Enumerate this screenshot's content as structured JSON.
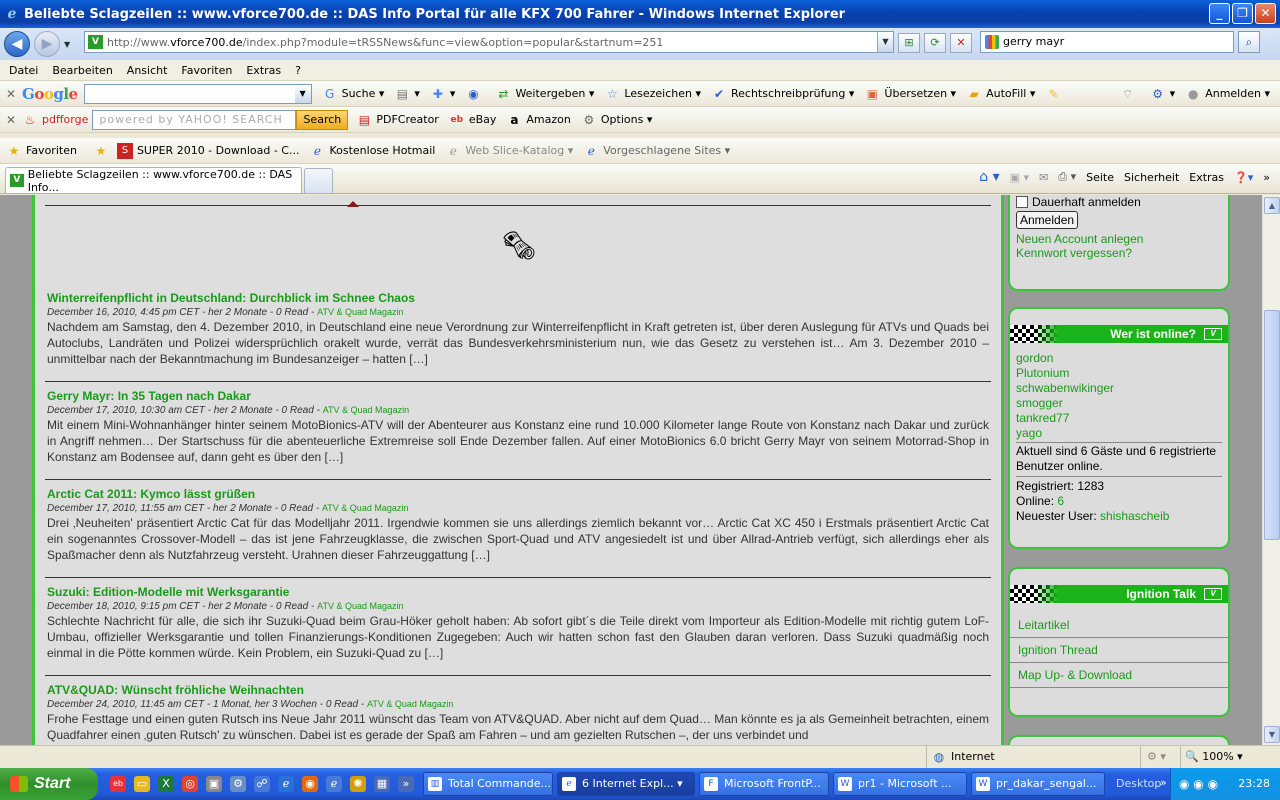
{
  "window": {
    "title": "Beliebte Sclagzeilen :: www.vforce700.de :: DAS Info Portal für alle KFX 700 Fahrer - Windows Internet Explorer",
    "minimize_label": "_",
    "maximize_label": "❐",
    "close_label": "✕"
  },
  "address": {
    "url_prefix": "http://www.",
    "url_host": "vforce700.de",
    "url_path": "/index.php?module=tRSSNews&func=view&option=popular&startnum=251",
    "search_value": "gerry mayr"
  },
  "menu": [
    "Datei",
    "Bearbeiten",
    "Ansicht",
    "Favoriten",
    "Extras",
    "?"
  ],
  "google_toolbar": {
    "logo": "Google",
    "items": [
      "Suche",
      "Weitergeben",
      "Lesezeichen",
      "Rechtschreibprüfung",
      "Übersetzen",
      "AutoFill",
      "Anmelden"
    ]
  },
  "pdf_toolbar": {
    "logo": "pdfforge",
    "yahoo_placeholder": "powered by YAHOO! SEARCH",
    "search_button": "Search",
    "items": [
      "PDFCreator",
      "eBay",
      "Amazon",
      "Options"
    ]
  },
  "favorites_bar": {
    "favorites_label": "Favoriten",
    "items": [
      "SUPER 2010 - Download - C...",
      "Kostenlose Hotmail",
      "Web Slice-Katalog",
      "Vorgeschlagene Sites"
    ]
  },
  "tab": {
    "title": "Beliebte Sclagzeilen :: www.vforce700.de :: DAS Info..."
  },
  "command_bar": [
    "Seite",
    "Sicherheit",
    "Extras"
  ],
  "articles": [
    {
      "title": "Winterreifenpflicht in Deutschland: Durchblick im Schnee Chaos",
      "meta": "December 16, 2010, 4:45 pm CET - her 2 Monate   - 0  Read  -",
      "category": "ATV & Quad Magazin",
      "body": "Nachdem am Samstag, den 4. Dezember 2010, in Deutschland eine neue Verordnung zur Winterreifenpflicht in Kraft getreten ist, über deren Auslegung für ATVs und Quads bei Autoclubs, Landräten und Polizei widersprüchlich orakelt wurde, verrät das Bundesverkehrsministerium nun, wie das Gesetz zu verstehen ist… Am 3. Dezember 2010 – unmittelbar nach der Bekanntmachung im Bundesanzeiger – hatten […]"
    },
    {
      "title": "Gerry Mayr: In 35 Tagen nach Dakar",
      "meta": "December 17, 2010, 10:30 am CET - her 2 Monate   - 0  Read  -",
      "category": "ATV & Quad Magazin",
      "body": "Mit einem Mini-Wohnanhänger hinter seinem MotoBionics-ATV will der Abenteurer aus Konstanz eine rund 10.000 Kilometer lange Route von Konstanz nach Dakar und zurück in Angriff nehmen… Der Startschuss für die abenteuerliche Extremreise soll Ende Dezember fallen. Auf einer MotoBionics 6.0 bricht Gerry Mayr von seinem Motorrad-Shop in Konstanz am Bodensee auf, dann geht es über den […]"
    },
    {
      "title": "Arctic Cat 2011: Kymco lässt grüßen",
      "meta": "December 17, 2010, 11:55 am CET - her 2 Monate   - 0  Read  -",
      "category": "ATV & Quad Magazin",
      "body": "Drei ‚Neuheiten' präsentiert Arctic Cat für das Modelljahr 2011. Irgendwie kommen sie uns allerdings ziemlich bekannt vor… Arctic Cat XC 450 i Erstmals präsentiert Arctic Cat ein sogenanntes Crossover-Modell – das ist jene Fahrzeugklasse, die zwischen Sport-Quad und ATV angesiedelt ist und über Allrad-Antrieb verfügt, sich allerdings eher als Spaßmacher denn als Nutzfahrzeug versteht. Urahnen dieser Fahrzeuggattung […]"
    },
    {
      "title": "Suzuki: Edition-Modelle mit Werksgarantie",
      "meta": "December 18, 2010, 9:15 pm CET - her 2 Monate   - 0  Read  -",
      "category": "ATV & Quad Magazin",
      "body": "Schlechte Nachricht für alle, die sich ihr Suzuki-Quad beim Grau-Höker geholt haben: Ab sofort gibt´s die Teile direkt vom Importeur als Edition-Modelle mit richtig gutem LoF-Umbau, offizieller Werksgarantie und tollen Finanzierungs-Konditionen Zugegeben: Auch wir hatten schon fast den Glauben daran verloren. Dass Suzuki quadmäßig noch einmal in die Pötte kommen würde. Kein Problem, ein Suzuki-Quad zu […]"
    },
    {
      "title": "ATV&QUAD: Wünscht fröhliche Weihnachten",
      "meta": "December 24, 2010, 11:45 am CET - 1 Monat, her 3 Wochen   - 0  Read  -",
      "category": "ATV & Quad Magazin",
      "body": "Frohe Festtage und einen guten Rutsch ins Neue Jahr 2011 wünscht das Team von ATV&QUAD. Aber nicht auf dem Quad… Man könnte es ja als Gemeinheit betrachten, einem Quadfahrer einen ‚guten Rutsch' zu wünschen. Dabei ist es gerade der Spaß am Fahren – und am gezielten Rutschen –, der uns verbindet und"
    }
  ],
  "login_box": {
    "remember_label": "Dauerhaft anmelden",
    "login_button": "Anmelden",
    "new_account": "Neuen Account anlegen",
    "forgot_password": "Kennwort vergessen?"
  },
  "online_box": {
    "header": "Wer ist online?",
    "logo_text": "V",
    "users": [
      "gordon",
      "Plutonium",
      "schwabenwikinger",
      "smogger",
      "tankred77",
      "yago"
    ],
    "summary": "Aktuell sind 6 Gäste und 6 registrierte Benutzer online.",
    "registered": "Registriert: 1283",
    "online_label": "Online:",
    "online_value": "6",
    "newest_label": "Neuester User:",
    "newest_value": "shishascheib"
  },
  "ignition_box": {
    "header": "Ignition Talk",
    "links": [
      "Leitartikel",
      "Ignition Thread",
      "Map Up- & Download"
    ]
  },
  "status": {
    "zone": "Internet",
    "zoom": "100%"
  },
  "taskbar": {
    "start_label": "Start",
    "tasks": [
      "Total Commande...",
      "6 Internet Expl...",
      "Microsoft FrontP...",
      "pr1 - Microsoft ...",
      "pr_dakar_sengal..."
    ],
    "desktop_label": "Desktop",
    "clock": "23:28"
  },
  "colors": {
    "accent_green": "#1ab41a",
    "link_green": "#1a9a1a",
    "title_blue": "#0842b0"
  }
}
